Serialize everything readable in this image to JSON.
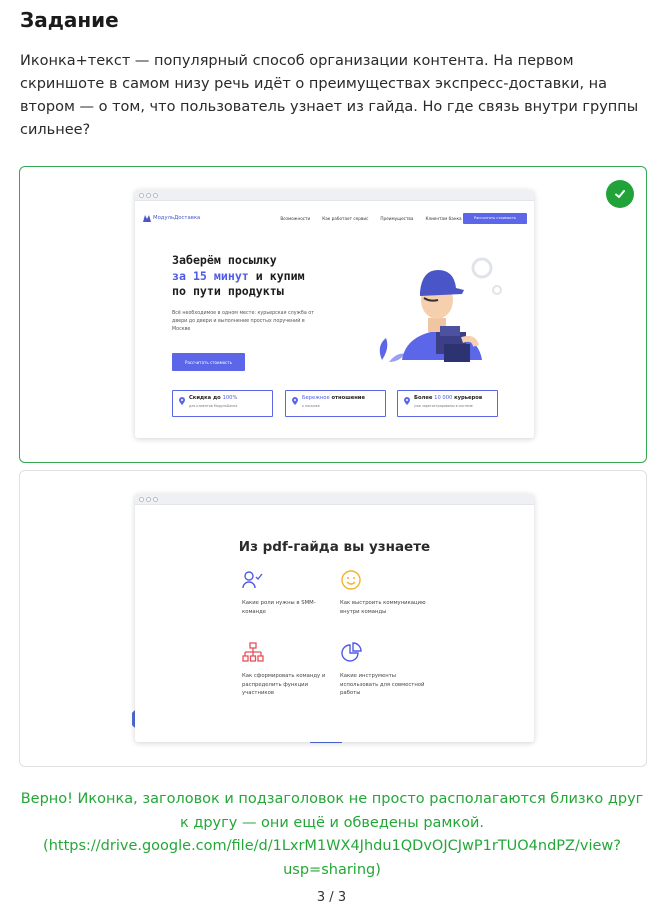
{
  "task": {
    "title": "Задание",
    "text": "Иконка+текст — популярный способ организации контента. На первом скриншоте в самом низу речь идёт о преимуществах экспресс-доставки, на втором — о том, что пользователь узнает из гайда. Но где связь внутри группы сильнее?"
  },
  "options": [
    {
      "state": "correct",
      "landing": {
        "logo": "МодульДоставка",
        "nav": [
          "Возможности",
          "Как работает сервис",
          "Преимущества",
          "Клиентам банка"
        ],
        "nav_button": "Рассчитать стоимость",
        "hero_line1": "Заберём посылку",
        "hero_accent": "за 15 минут",
        "hero_line2_rest": " и купим",
        "hero_line3": "по пути продукты",
        "hero_sub": "Всё необходимое в одном месте: курьерская служба от двери до двери и выполнение простых поручений в Москве",
        "hero_button": "Рассчитать стоимость",
        "features": [
          {
            "title_pre": "Скидка до ",
            "title_accent": "100%",
            "title_post": "",
            "sub": "для клиентов МодульБанка"
          },
          {
            "title_pre": "",
            "title_accent": "Бережное",
            "title_post": " отношение",
            "sub": "к посылке"
          },
          {
            "title_pre": "Более ",
            "title_accent": "10 000",
            "title_post": " курьеров",
            "sub": "уже зарегистрированы в системе"
          }
        ]
      }
    },
    {
      "state": "neutral",
      "guide": {
        "title": "Из pdf-гайда вы узнаете",
        "items": [
          {
            "icon": "users-check-icon",
            "text": "Какие роли нужны в SMM-команде"
          },
          {
            "icon": "smile-icon",
            "text": "Как выстроить коммуникацию внутри команды"
          },
          {
            "icon": "hierarchy-icon",
            "text": "Как сформировать команду и распределить функции участников"
          },
          {
            "icon": "pie-chart-icon",
            "text": "Какие инструменты использовать для совместной работы"
          }
        ]
      }
    }
  ],
  "feedback": "Верно! Иконка, заголовок и подзаголовок не просто располагаются близко друг к другу — они ещё и обведены рамкой. (https://drive.google.com/file/d/1LxrM1WX4Jhdu1QDvOJCJwP1rTUO4ndPZ/view?usp=sharing)",
  "pager": "3 / 3",
  "colors": {
    "correct": "#22a33a",
    "accent": "#5b67e8",
    "border": "#e0e0e0"
  }
}
